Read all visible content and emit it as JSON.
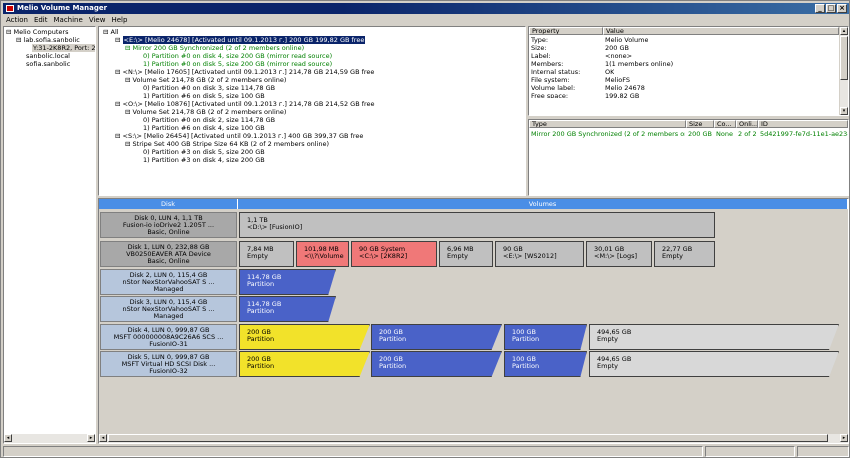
{
  "window": {
    "title": "Melio Volume Manager"
  },
  "menu": [
    "Action",
    "Edit",
    "Machine",
    "View",
    "Help"
  ],
  "computers": {
    "root": "Melio Computers",
    "items": [
      "lab.sofia.sanbolic",
      "Y:31-2K8R2, Port: 24",
      "sanbolic.local",
      "sofia.sanbolic"
    ]
  },
  "volume_tree": {
    "all": "All",
    "rows": [
      "<E:\\> [Melio 24678] [Activated until 09.1.2013 г.] 200 GB 199,82 GB free",
      "Mirror 200 GB Synchronized (2 of 2 members online)",
      "0) Partition #0 on disk 4, size 200 GB (mirror read source)",
      "1) Partition #0 on disk 5, size 200 GB (mirror read source)",
      "<N:\\> [Melio 17605] [Activated until 09.1.2013 г.] 214,78 GB 214,59 GB free",
      "Volume Set 214,78 GB (2 of 2 members online)",
      "0) Partition #0 on disk 3, size 114,78 GB",
      "1) Partition #6 on disk 5, size 100 GB",
      "<O:\\> [Melio 10876] [Activated until 09.1.2013 г.] 214,78 GB 214,52 GB free",
      "Volume Set 214,78 GB (2 of 2 members online)",
      "0) Partition #0 on disk 2, size 114,78 GB",
      "1) Partition #6 on disk 4, size 100 GB",
      "<S:\\> [Melio 26454] [Activated until 09.1.2013 г.] 400 GB 399,37 GB free",
      "Stripe Set 400 GB Stripe Size 64 KB (2 of 2 members online)",
      "0) Partition #3 on disk 5, size 200 GB",
      "1) Partition #3 on disk 4, size 200 GB"
    ]
  },
  "properties": {
    "headers": [
      "Property",
      "Value"
    ],
    "rows": [
      [
        "Type:",
        "Melio Volume"
      ],
      [
        "Size:",
        "200 GB"
      ],
      [
        "Label:",
        "<none>"
      ],
      [
        "Members:",
        "1(1 members online)"
      ],
      [
        "Internal status:",
        "OK"
      ],
      [
        "File system:",
        "MelioFS"
      ],
      [
        "Volume label:",
        "Melio 24678"
      ],
      [
        "Free space:",
        "199,82 GB"
      ]
    ]
  },
  "members": {
    "headers": [
      "Type",
      "Size",
      "Co...",
      "Onli...",
      "ID"
    ],
    "row": [
      "Mirror 200 GB Synchronized (2 of 2 members online)",
      "200 GB",
      "None",
      "2 of 2",
      "5d421997-fe7d-11e1-ae23-009c0"
    ]
  },
  "disk_panel": {
    "col_disk": "Disk",
    "col_volumes": "Volumes"
  },
  "disks": [
    {
      "l1": "Disk 0, LUN 4, 1,1 TB",
      "l2": "Fusion-io ioDrive2 1.205T ...",
      "l3": "Basic, Online",
      "parts": [
        {
          "a": "1,1 TB",
          "b": "<D:\\> [FusionIO]"
        }
      ]
    },
    {
      "l1": "Disk 1, LUN 0, 232,88 GB",
      "l2": "VB0250EAVER ATA Device",
      "l3": "Basic, Online",
      "parts": [
        {
          "a": "7,84 MB",
          "b": "Empty"
        },
        {
          "a": "101,98 MB",
          "b": "<\\\\?\\Volume"
        },
        {
          "a": "90 GB System",
          "b": "<C:\\> [2K8R2]"
        },
        {
          "a": "6,96 MB",
          "b": "Empty"
        },
        {
          "a": "90 GB",
          "b": "<E:\\> [WS2012]"
        },
        {
          "a": "30,01 GB",
          "b": "<M:\\> [Logs]"
        },
        {
          "a": "22,77 GB",
          "b": "Empty"
        }
      ]
    },
    {
      "l1": "Disk 2, LUN 0, 115,4 GB",
      "l2": "nStor  NexStorVahooSAT S ...",
      "l3": "Managed",
      "parts": [
        {
          "a": "114,78 GB",
          "b": "Partition"
        }
      ]
    },
    {
      "l1": "Disk 3, LUN 0, 115,4 GB",
      "l2": "nStor  NexStorVahooSAT S ...",
      "l3": "Managed",
      "parts": [
        {
          "a": "114,78 GB",
          "b": "Partition"
        }
      ]
    },
    {
      "l1": "Disk 4, LUN 0, 999,87 GB",
      "l2": "MSFT 000000008A9C26A6 SCS ...",
      "l3": "FusionIO-31",
      "parts": [
        {
          "a": "200 GB",
          "b": "Partition"
        },
        {
          "a": "200 GB",
          "b": "Partition"
        },
        {
          "a": "100 GB",
          "b": "Partition"
        },
        {
          "a": "494,65 GB",
          "b": "Empty"
        }
      ]
    },
    {
      "l1": "Disk 5, LUN 0, 999,87 GB",
      "l2": "MSFT Virtual HD SCSI Disk ...",
      "l3": "FusionIO-32",
      "parts": [
        {
          "a": "200 GB",
          "b": "Partition"
        },
        {
          "a": "200 GB",
          "b": "Partition"
        },
        {
          "a": "100 GB",
          "b": "Partition"
        },
        {
          "a": "494,65 GB",
          "b": "Empty"
        }
      ]
    }
  ]
}
